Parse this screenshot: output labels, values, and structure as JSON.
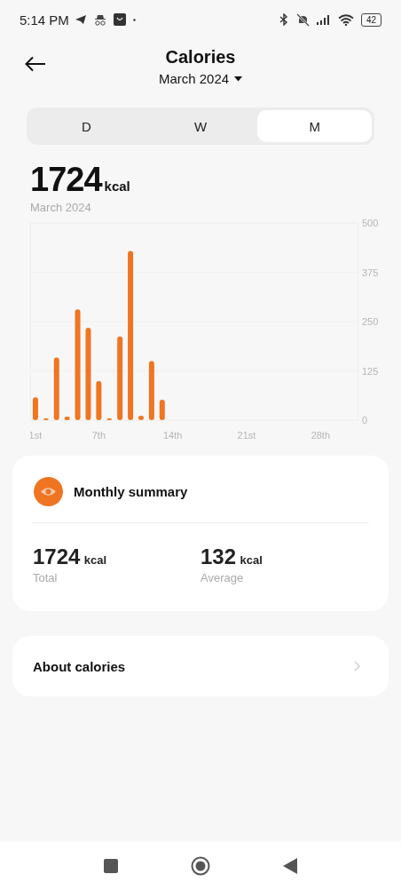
{
  "status_bar": {
    "time": "5:14 PM",
    "battery": "42"
  },
  "header": {
    "title": "Calories",
    "period": "March 2024"
  },
  "tabs": [
    {
      "label": "D",
      "selected": false
    },
    {
      "label": "W",
      "selected": false
    },
    {
      "label": "M",
      "selected": true
    }
  ],
  "total": {
    "value": "1724",
    "unit": "kcal",
    "period": "March 2024"
  },
  "chart_data": {
    "type": "bar",
    "x": [
      1,
      2,
      3,
      4,
      5,
      6,
      7,
      8,
      9,
      10,
      11,
      12,
      13
    ],
    "series": [
      {
        "color": "#f07522",
        "values": [
          58,
          2,
          159,
          9,
          281,
          234,
          99,
          4,
          212,
          429,
          11,
          150,
          52
        ]
      }
    ],
    "xlim": [
      0.5,
      31.5
    ],
    "ylim": [
      0,
      500
    ],
    "yticks": [
      0,
      125,
      250,
      375,
      500
    ],
    "xticks": [
      {
        "value": 1,
        "label": "1st"
      },
      {
        "value": 7,
        "label": "7th"
      },
      {
        "value": 14,
        "label": "14th"
      },
      {
        "value": 21,
        "label": "21st"
      },
      {
        "value": 28,
        "label": "28th"
      }
    ]
  },
  "summary": {
    "title": "Monthly summary",
    "stats": [
      {
        "value": "1724",
        "unit": "kcal",
        "label": "Total"
      },
      {
        "value": "132",
        "unit": "kcal",
        "label": "Average"
      }
    ]
  },
  "about": {
    "label": "About calories"
  }
}
